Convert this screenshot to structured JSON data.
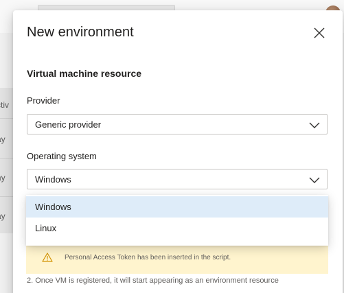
{
  "background": {
    "table_rows": [
      "ay",
      "ay",
      "ay"
    ],
    "table_header": "ctiv"
  },
  "dialog": {
    "title": "New environment",
    "close_icon": "close-icon",
    "section_heading": "Virtual machine resource",
    "provider": {
      "label": "Provider",
      "value": "Generic provider"
    },
    "operating_system": {
      "label": "Operating system",
      "value": "Windows",
      "options": [
        {
          "label": "Windows",
          "selected": true
        },
        {
          "label": "Linux",
          "selected": false
        }
      ]
    },
    "callout": {
      "icon": "warning-icon",
      "message": "Personal Access Token has been inserted in the script."
    },
    "step_text": "2. Once VM is registered, it will start appearing as an environment resource"
  },
  "colors": {
    "selected_option_bg": "#deecf9",
    "callout_bg": "#fff4ce",
    "warning_icon": "#d29200"
  }
}
